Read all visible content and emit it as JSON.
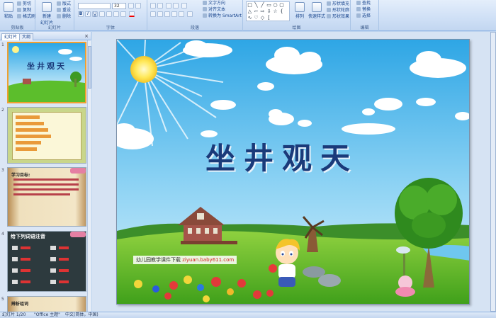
{
  "ribbon": {
    "groups": [
      {
        "key": "clipboard",
        "label": "剪贴板"
      },
      {
        "key": "slides",
        "label": "幻灯片"
      },
      {
        "key": "font",
        "label": "字体"
      },
      {
        "key": "paragraph",
        "label": "段落"
      },
      {
        "key": "drawing",
        "label": "绘图"
      },
      {
        "key": "editing",
        "label": "编辑"
      }
    ],
    "clipboard": {
      "paste": "粘贴",
      "cut": "剪切",
      "copy": "复制",
      "format_painter": "格式刷"
    },
    "slides": {
      "new_slide": "新建\n幻灯片",
      "layout": "版式",
      "reset": "重设",
      "delete": "删除"
    },
    "font": {
      "font_name": "",
      "font_size": "32"
    },
    "paragraph": {
      "text_direction": "文字方向",
      "align_text": "对齐文本",
      "convert_smartart": "转换为 SmartArt"
    },
    "drawing": {
      "arrange": "排列",
      "quick_styles": "快速样式",
      "shape_fill": "形状填充",
      "shape_outline": "形状轮廓",
      "shape_effects": "形状效果"
    },
    "editing": {
      "find": "查找",
      "replace": "替换",
      "select": "选择"
    }
  },
  "panel": {
    "tab_slides": "幻灯片",
    "tab_outline": "大纲"
  },
  "thumbnails": [
    {
      "num": "1",
      "title": "坐井观天"
    },
    {
      "num": "2",
      "title": ""
    },
    {
      "num": "3",
      "title": "学习目标:"
    },
    {
      "num": "4",
      "title": "给下列词语注音"
    },
    {
      "num": "5",
      "title": "辨析组词"
    }
  ],
  "slide": {
    "title": "坐井观天",
    "credit_prefix": "幼儿园教学课件下载",
    "credit_url": "ziyuan.baby611.com"
  },
  "status": {
    "slide_counter": "幻灯片 1/20",
    "theme": "\"Office 主题\"",
    "language": "中文(简体，中国)"
  },
  "colors": {
    "ribbon_bg": "#cfe0f6",
    "sky_top": "#3cb2ea",
    "grass": "#5cbe2c",
    "title_color": "#1a3a7a"
  }
}
